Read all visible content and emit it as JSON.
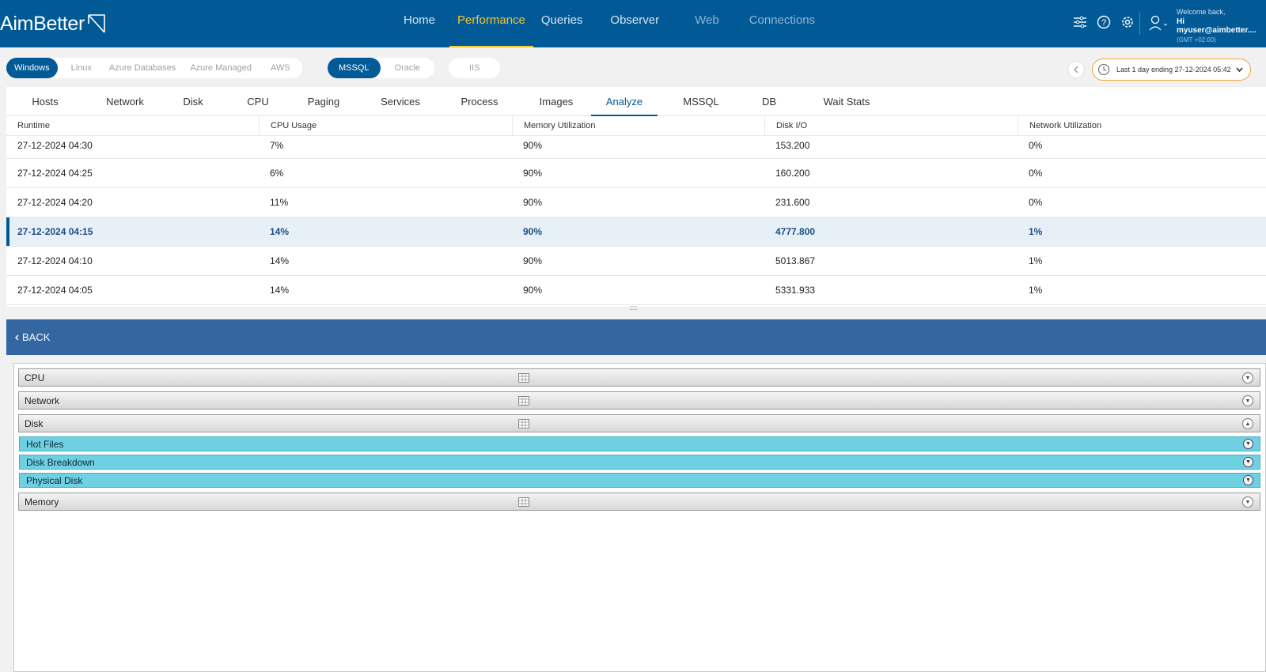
{
  "app": {
    "logo_text": "AimBetter",
    "nav": [
      "Home",
      "Performance",
      "Queries",
      "Observer",
      "Web",
      "Connections"
    ],
    "active_nav": "Performance",
    "user": {
      "welcome": "Welcome back,",
      "name": "Hi myuser@aimbetter....",
      "timezone": "(GMT +02:00)"
    }
  },
  "filters": {
    "platforms": [
      "Windows",
      "Linux",
      "Azure Databases",
      "Azure Managed",
      "AWS"
    ],
    "active_platform": "Windows",
    "engines": [
      "MSSQL",
      "Oracle"
    ],
    "active_engine": "MSSQL",
    "other": [
      "IIS"
    ],
    "time_range": "Last 1 day ending  27-12-2024 05:42"
  },
  "subtabs": [
    "Hosts",
    "Network",
    "Disk",
    "CPU",
    "Paging",
    "Services",
    "Process",
    "Images",
    "Analyze",
    "MSSQL",
    "DB",
    "Wait Stats"
  ],
  "active_subtab": "Analyze",
  "table": {
    "columns": [
      "Runtime",
      "CPU Usage",
      "Memory Utilization",
      "Disk I/O",
      "Network Utilization"
    ],
    "rows": [
      [
        "27-12-2024 04:30",
        "7%",
        "90%",
        "153.200",
        "0%"
      ],
      [
        "27-12-2024 04:25",
        "6%",
        "90%",
        "160.200",
        "0%"
      ],
      [
        "27-12-2024 04:20",
        "11%",
        "90%",
        "231.600",
        "0%"
      ],
      [
        "27-12-2024 04:15",
        "14%",
        "90%",
        "4777.800",
        "1%"
      ],
      [
        "27-12-2024 04:10",
        "14%",
        "90%",
        "5013.867",
        "1%"
      ],
      [
        "27-12-2024 04:05",
        "14%",
        "90%",
        "5331.933",
        "1%"
      ]
    ],
    "selected_row": 3
  },
  "back_label": "BACK",
  "accordion": {
    "sections": [
      "CPU",
      "Network",
      "Disk"
    ],
    "disk_subsections": [
      "Hot Files",
      "Disk Breakdown",
      "Physical Disk"
    ],
    "last_section": "Memory"
  },
  "colors": {
    "header": "#015a96",
    "accent": "#f5c431",
    "back_bar": "#3466a2",
    "subsection": "#6fd0e2"
  }
}
